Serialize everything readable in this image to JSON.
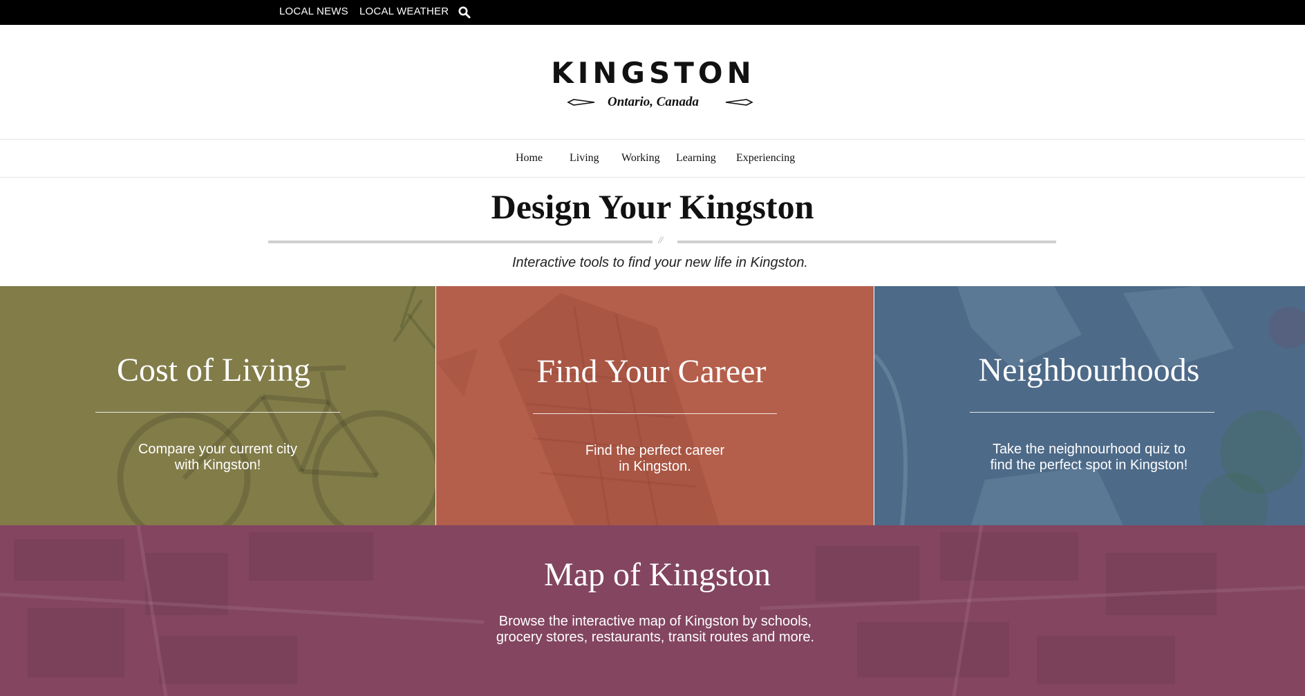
{
  "topbar": {
    "local_news": "LOCAL NEWS",
    "local_weather": "LOCAL WEATHER",
    "search_icon": "search-icon"
  },
  "logo": {
    "wordmark": "KINGSTON",
    "tagline": "Ontario, Canada"
  },
  "nav": {
    "items": [
      {
        "label": "Home"
      },
      {
        "label": "Living"
      },
      {
        "label": "Working"
      },
      {
        "label": "Learning"
      },
      {
        "label": "Experiencing"
      }
    ]
  },
  "intro": {
    "title": "Design Your Kingston",
    "divider_mark": "//",
    "subtitle": "Interactive tools to find your new life in Kingston."
  },
  "tiles": {
    "cost": {
      "title": "Cost of Living",
      "desc_line1": "Compare your current city",
      "desc_line2": "with Kingston!",
      "color": "#827c49"
    },
    "career": {
      "title": "Find Your Career",
      "desc_line1": "Find the perfect career",
      "desc_line2": "in Kingston.",
      "color": "#b45f4b"
    },
    "hood": {
      "title": "Neighbourhoods",
      "desc_line1": "Take the neighnourhood quiz to",
      "desc_line2": "find the perfect spot in Kingston!",
      "color": "#4d6a88"
    },
    "map": {
      "title": "Map of Kingston",
      "desc_line1": "Browse the interactive map of Kingston by schools,",
      "desc_line2": "grocery stores, restaurants, transit routes and more.",
      "color": "#83455f"
    }
  }
}
